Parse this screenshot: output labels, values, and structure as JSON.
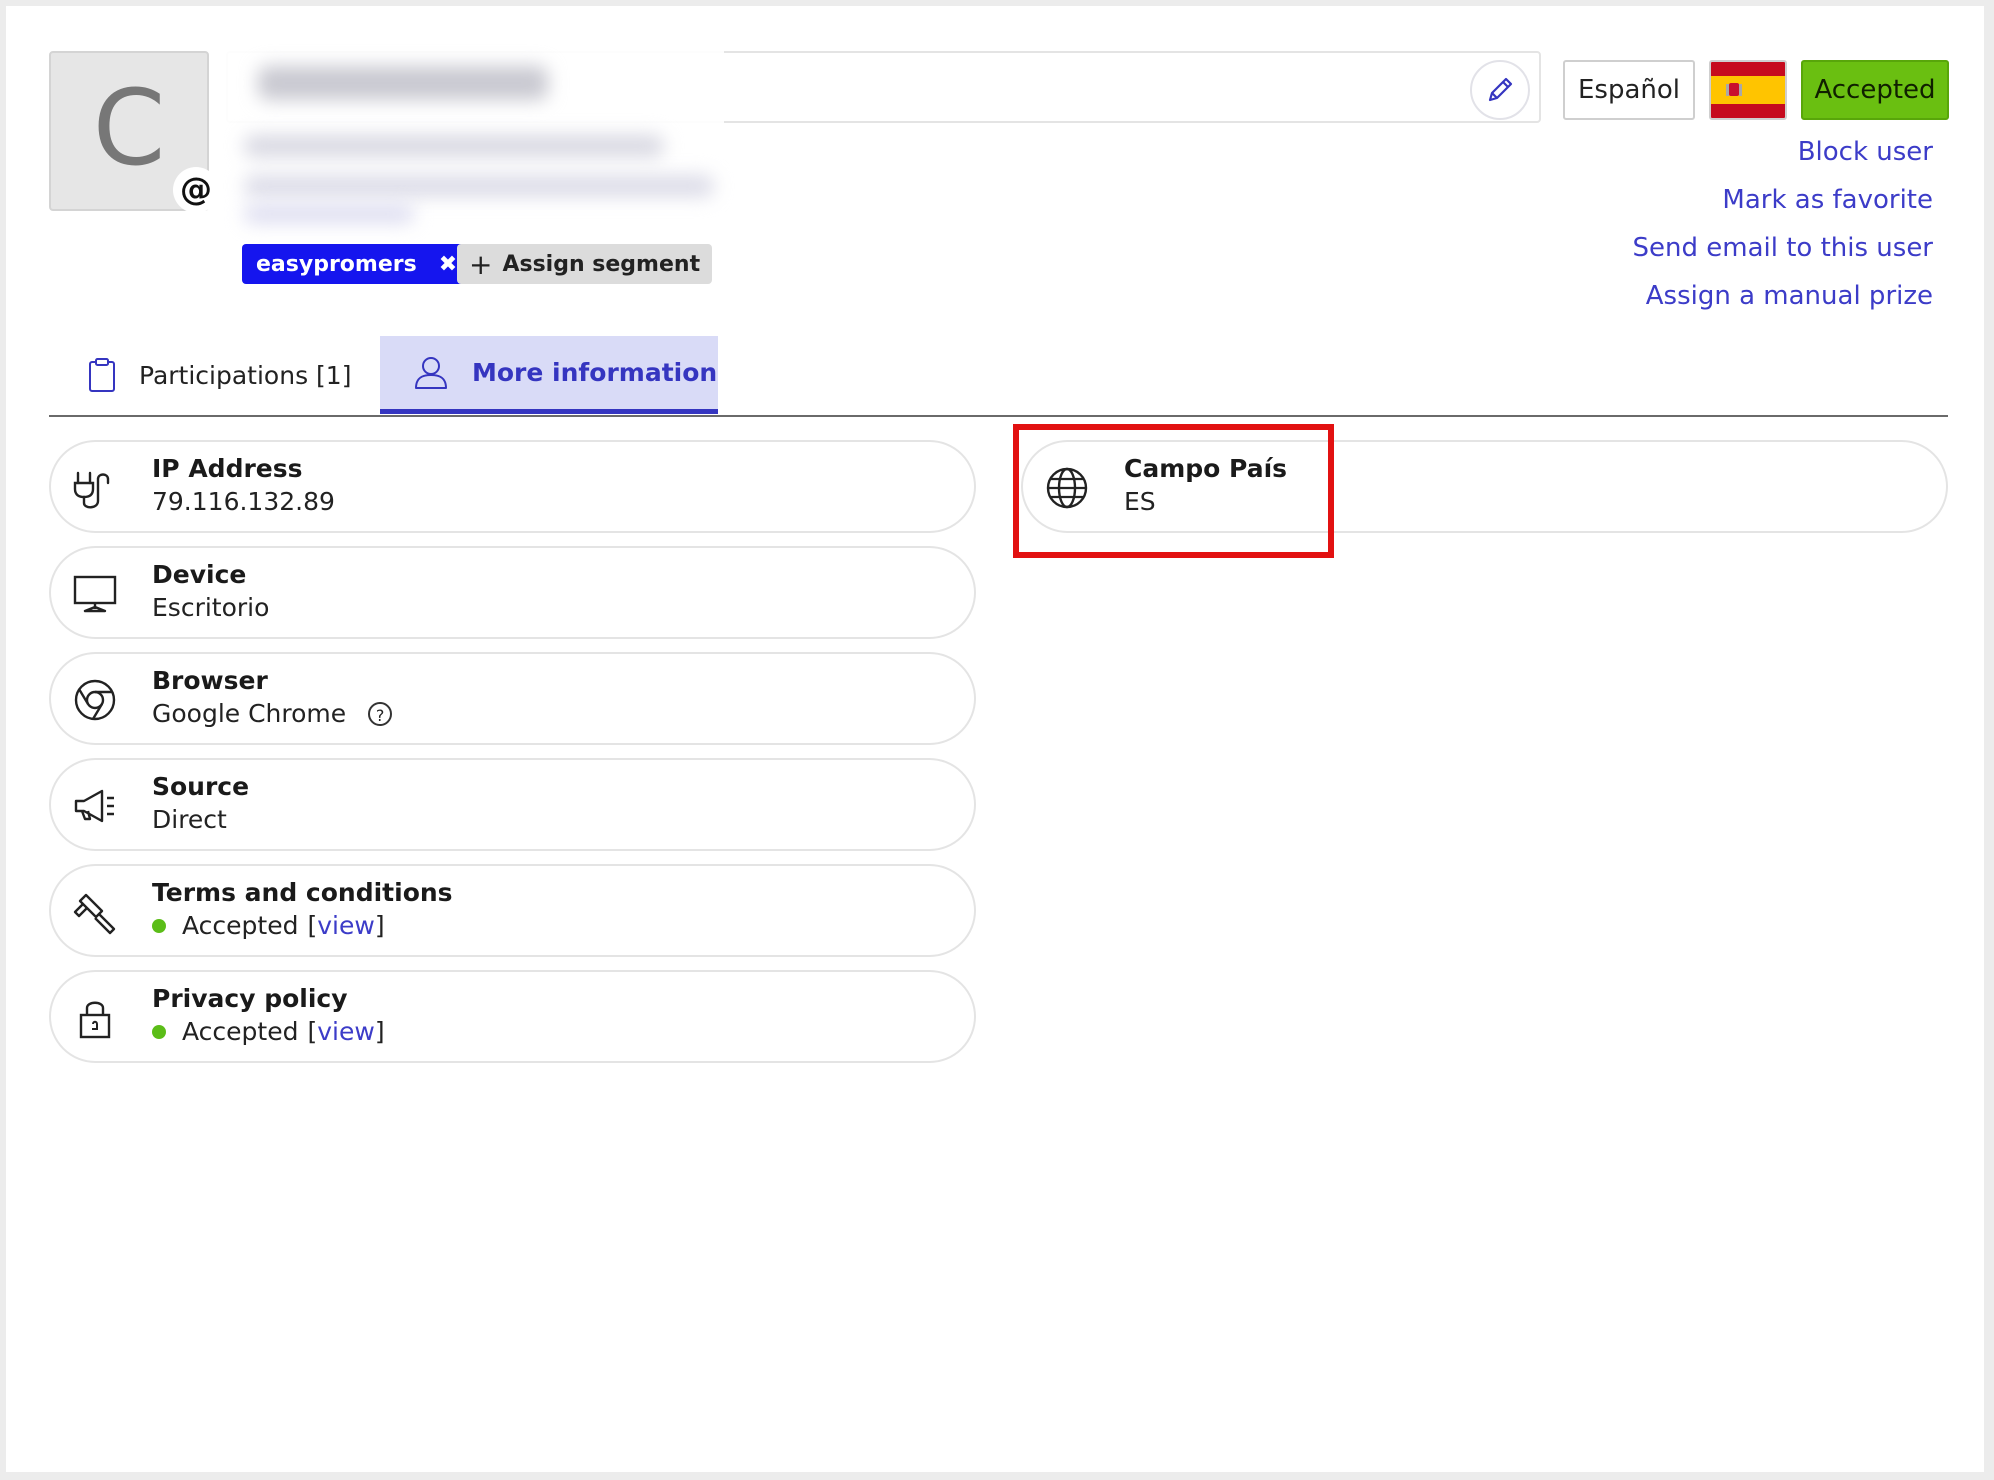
{
  "header": {
    "avatar_letter": "C",
    "avatar_badge": "@",
    "language_button": "Español",
    "flag_icon": "spain-flag-icon",
    "status_button": "Accepted",
    "actions": [
      "Block user",
      "Mark as favorite",
      "Send email to this user",
      "Assign a manual prize"
    ],
    "segment": {
      "label": "easypromers",
      "remove": "✖"
    },
    "assign_segment": {
      "plus": "+",
      "label": "Assign segment"
    }
  },
  "tabs": [
    {
      "label": "Participations [1]",
      "icon": "clipboard-icon",
      "active": false
    },
    {
      "label": "More information",
      "icon": "user-icon",
      "active": true
    }
  ],
  "info": {
    "ip": {
      "title": "IP Address",
      "value": "79.116.132.89",
      "icon": "plug-icon"
    },
    "device": {
      "title": "Device",
      "value": "Escritorio",
      "icon": "monitor-icon"
    },
    "browser": {
      "title": "Browser",
      "value": "Google Chrome",
      "icon": "chrome-icon",
      "help": "?"
    },
    "source": {
      "title": "Source",
      "value": "Direct",
      "icon": "megaphone-icon"
    },
    "terms": {
      "title": "Terms and conditions",
      "status": "Accepted",
      "open": "[",
      "link": "view",
      "close": "]",
      "icon": "gavel-icon"
    },
    "privacy": {
      "title": "Privacy policy",
      "status": "Accepted",
      "open": "[",
      "link": "view",
      "close": "]",
      "icon": "lock-icon"
    },
    "country": {
      "title": "Campo País",
      "value": "ES",
      "icon": "globe-icon"
    }
  },
  "colors": {
    "accent": "#3c3cc8",
    "status_green": "#6abf11",
    "segment_blue": "#1515ee",
    "highlight_red": "#e21111"
  }
}
